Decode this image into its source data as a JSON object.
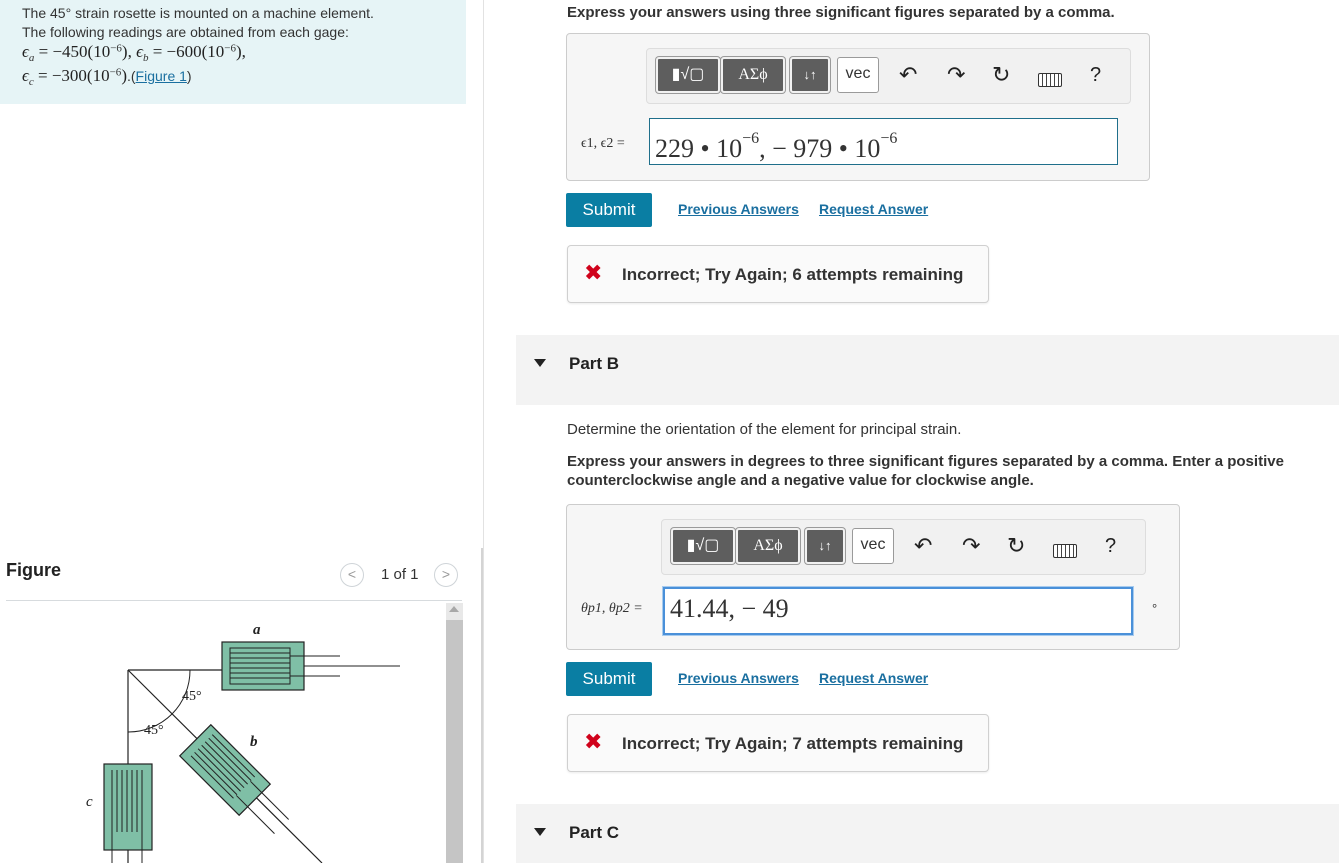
{
  "problem": {
    "line1": "The 45° strain rosette is mounted on a machine element.",
    "line2": "The following readings are obtained from each gage:",
    "eps_a_sym": "ϵ",
    "eps_a_sub": "a",
    "eps_a_val": " = −450(10",
    "eps_a_exp": "−6",
    "eps_b_sym": "ϵ",
    "eps_b_sub": "b",
    "eps_b_val": " = −600(10",
    "eps_b_exp": "−6",
    "eps_c_sym": "ϵ",
    "eps_c_sub": "c",
    "eps_c_val": " = −300(10",
    "eps_c_exp": "−6",
    "figure_link": "Figure 1"
  },
  "figure": {
    "title": "Figure",
    "pager": "1 of 1",
    "prev_glyph": "<",
    "next_glyph": ">",
    "label_a": "a",
    "label_b": "b",
    "label_c": "c",
    "angle_1": "45°",
    "angle_2": "45°"
  },
  "toolbar": {
    "templates_icon": "▮√▢",
    "greek_label": "ΑΣϕ",
    "arrows_label": "↓↑",
    "vec_label": "vec",
    "undo_glyph": "↶",
    "redo_glyph": "↷",
    "reset_glyph": "↻",
    "help_label": "?"
  },
  "partA": {
    "instruction": "Express your answers using three significant figures separated by a comma.",
    "field_label": "ϵ1, ϵ2 =",
    "answer_a": "229 • 10",
    "answer_a_exp": "−6",
    "answer_sep": ", − 979 • 10",
    "answer_b_exp": "−6",
    "submit": "Submit",
    "previous_answers": "Previous Answers",
    "request_answer": "Request Answer",
    "feedback_icon": "✖",
    "feedback": "Incorrect; Try Again; 6 attempts remaining"
  },
  "partB": {
    "label": "Part B",
    "question": "Determine the orientation of the element for principal strain.",
    "instruction_line1": "Express your answers in degrees to three significant figures separated by a comma. Enter a positive",
    "instruction_line2": "counterclockwise angle and a negative value for clockwise angle.",
    "field_label": "θp1, θp2 =",
    "answer": "41.44, − 49",
    "unit": "°",
    "submit": "Submit",
    "previous_answers": "Previous Answers",
    "request_answer": "Request Answer",
    "feedback_icon": "✖",
    "feedback": "Incorrect; Try Again; 7 attempts remaining"
  },
  "partC": {
    "label": "Part C"
  },
  "colors": {
    "accent": "#0a7ea3",
    "link": "#1a6fa0",
    "error": "#d0021b",
    "problem_bg": "#e6f4f6",
    "gage_fill": "#7fbfa6"
  }
}
